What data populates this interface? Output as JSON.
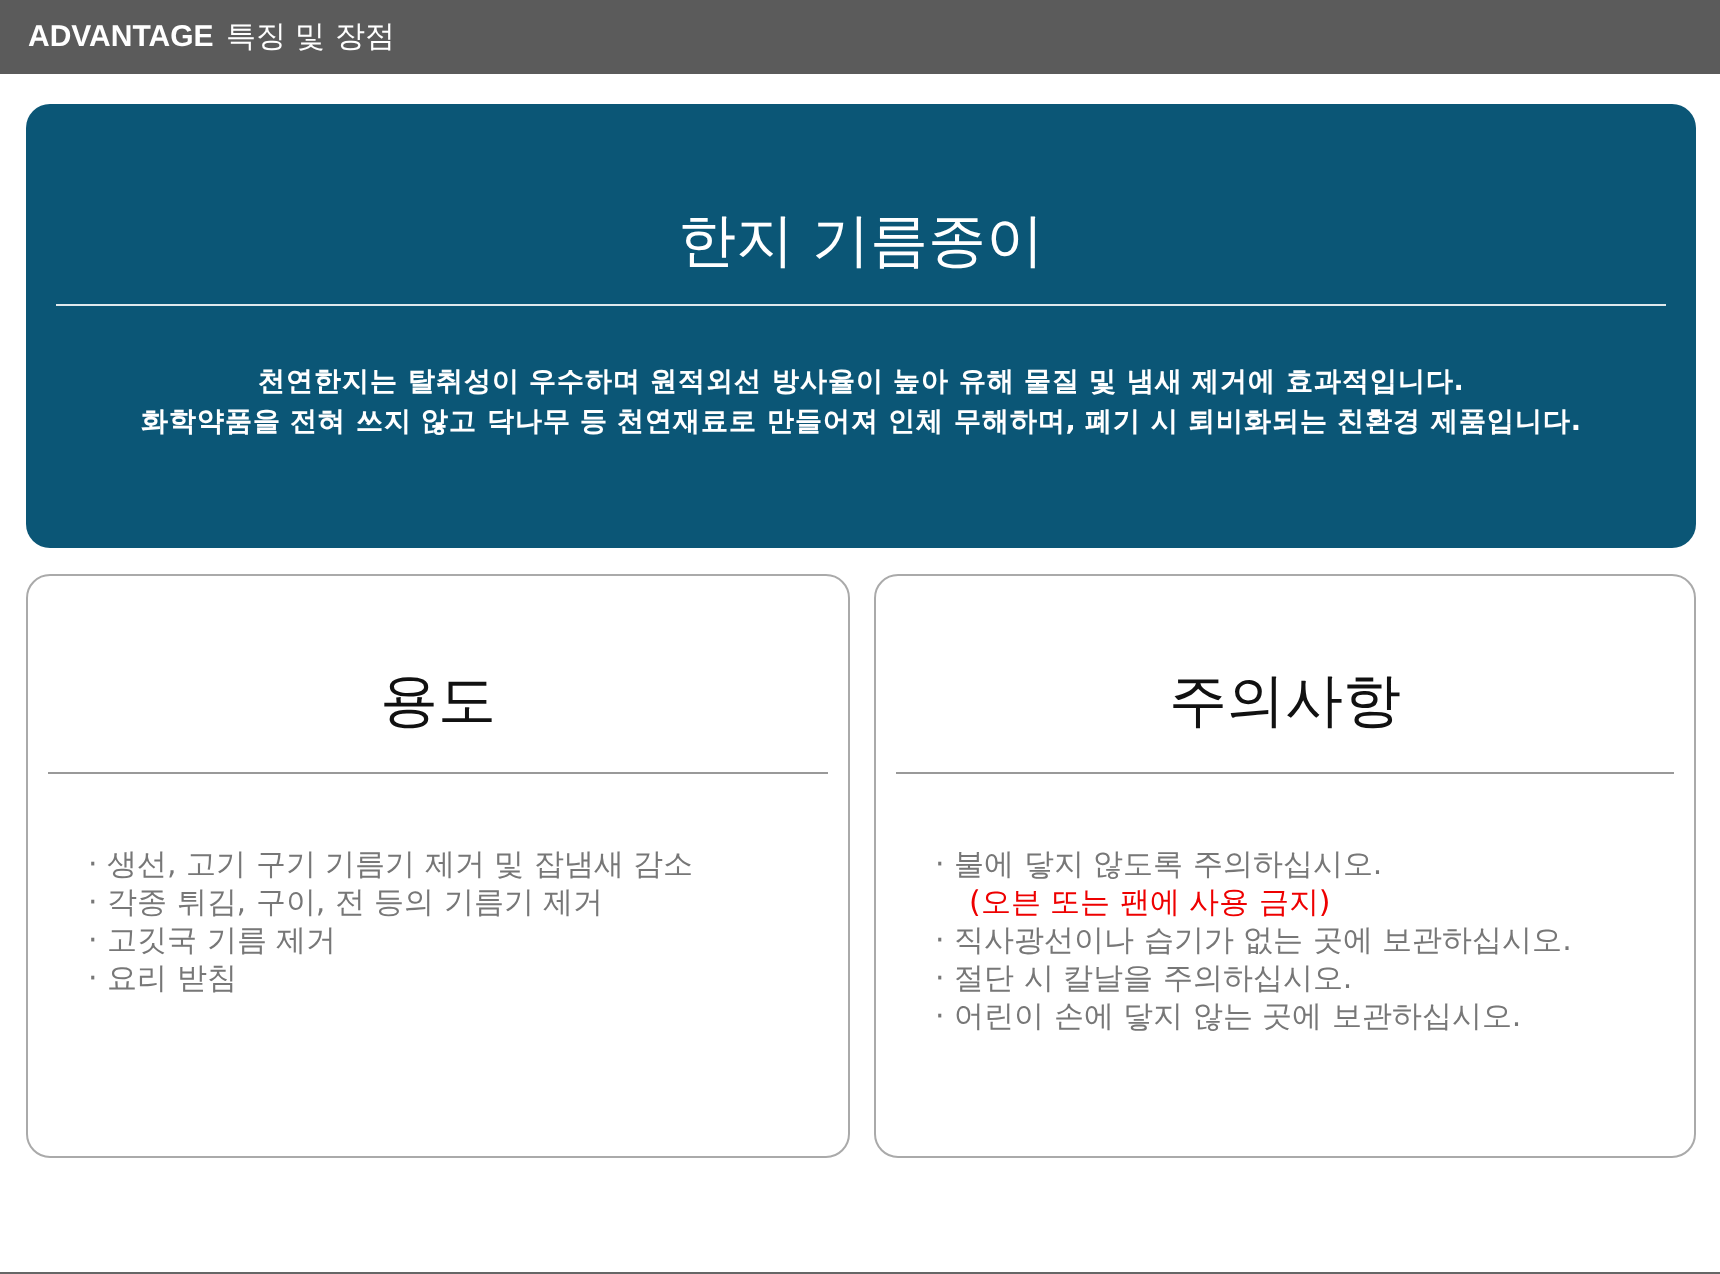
{
  "header": {
    "brand": "ADVANTAGE",
    "title": "특징 및 장점"
  },
  "hero": {
    "title": "한지 기름종이",
    "lines": [
      "천연한지는 탈취성이 우수하며 원적외선 방사율이 높아 유해 물질 및 냄새 제거에 효과적입니다.",
      "화학약품을 전혀 쓰지 않고 닥나무 등 천연재료로 만들어져 인체 무해하며, 폐기 시 퇴비화되는 친환경 제품입니다."
    ]
  },
  "cards": [
    {
      "title": "용도",
      "items": [
        {
          "kind": "item",
          "text": "· 생선, 고기 구기 기름기 제거 및 잡냄새 감소"
        },
        {
          "kind": "item",
          "text": "· 각종 튀김, 구이, 전 등의 기름기 제거"
        },
        {
          "kind": "item",
          "text": "· 고깃국 기름 제거"
        },
        {
          "kind": "item",
          "text": "· 요리 받침"
        }
      ]
    },
    {
      "title": "주의사항",
      "items": [
        {
          "kind": "item",
          "text": "· 불에 닿지 않도록 주의하십시오."
        },
        {
          "kind": "warning",
          "text": "(오븐 또는 팬에 사용 금지)"
        },
        {
          "kind": "item",
          "text": "· 직사광선이나 습기가 없는 곳에 보관하십시오."
        },
        {
          "kind": "item",
          "text": "· 절단 시 칼날을 주의하십시오."
        },
        {
          "kind": "item",
          "text": "· 어린이 손에 닿지 않는 곳에 보관하십시오."
        }
      ]
    }
  ]
}
